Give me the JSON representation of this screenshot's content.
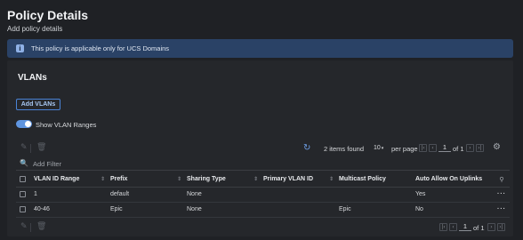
{
  "page": {
    "title": "Policy Details",
    "subtitle": "Add policy details"
  },
  "banner": {
    "icon": "info-icon",
    "text": "This policy is applicable only for UCS Domains",
    "color": "#2a4266"
  },
  "section": {
    "title": "VLANs",
    "add_button": "Add VLANs",
    "toggle_label": "Show VLAN Ranges",
    "toggle_on": true
  },
  "toolbar": {
    "items_found": "2 items found",
    "per_page_value": "10",
    "per_page_label": "per page",
    "page_current": "1",
    "page_of": "of 1"
  },
  "filter": {
    "placeholder": "Add Filter"
  },
  "table": {
    "columns": [
      "VLAN ID Range",
      "Prefix",
      "Sharing Type",
      "Primary VLAN ID",
      "Multicast Policy",
      "Auto Allow On Uplinks"
    ],
    "rows": [
      [
        "1",
        "default",
        "None",
        "",
        "",
        "Yes"
      ],
      [
        "40-46",
        "Epic",
        "None",
        "",
        "Epic",
        "No"
      ]
    ]
  },
  "footer": {
    "page_current": "1",
    "page_of": "of 1"
  },
  "colors": {
    "accent": "#5f95e0",
    "background": "#1f2125"
  }
}
